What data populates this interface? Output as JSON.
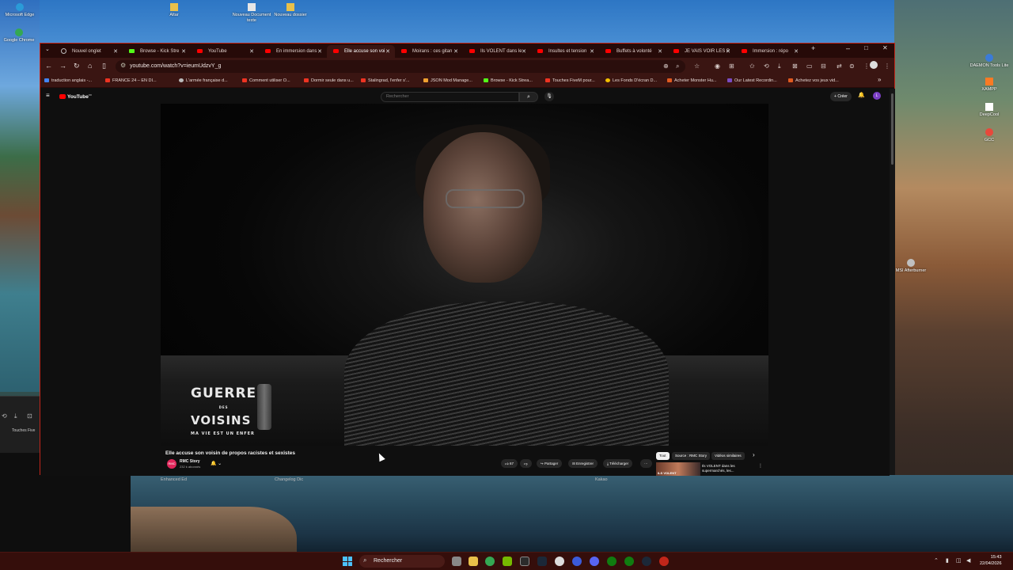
{
  "desktop": {
    "icons_top": [
      {
        "label": "Microsoft Edge"
      },
      {
        "label": "Altar"
      },
      {
        "label": "Nouveau Document texte"
      },
      {
        "label": "Nouveau dossier"
      },
      {
        "label": "Google Chrome"
      }
    ],
    "icons_right": [
      {
        "label": "DAEMON Tools Lite"
      },
      {
        "label": "XAMPP"
      },
      {
        "label": "DeepCool"
      },
      {
        "label": "GCC"
      },
      {
        "label": "MSI Afterburner"
      }
    ],
    "left_fragment_text": "Touches Five",
    "under_browser": [
      "Enhanced Ed",
      "Changelog Dic",
      "Kakao"
    ]
  },
  "browser": {
    "tabs": [
      {
        "title": "Nouvel onglet",
        "icon": "chrome"
      },
      {
        "title": "Browse - Kick Stre",
        "icon": "kick"
      },
      {
        "title": "YouTube",
        "icon": "youtube"
      },
      {
        "title": "En immersion dans",
        "icon": "youtube"
      },
      {
        "title": "Elle accuse son voi",
        "icon": "youtube",
        "active": true
      },
      {
        "title": "Moirans : ces gitan",
        "icon": "youtube"
      },
      {
        "title": "Ils VOLENT dans le",
        "icon": "youtube"
      },
      {
        "title": "Insultes et tension",
        "icon": "youtube"
      },
      {
        "title": "Buffets à volonté",
        "icon": "youtube"
      },
      {
        "title": "JE VAIS VOIR LES P",
        "icon": "youtube"
      },
      {
        "title": "Immersion : répo",
        "icon": "youtube"
      }
    ],
    "new_tab": "+",
    "window_controls": {
      "minimize": "–",
      "maximize": "□",
      "close": "✕"
    },
    "url": "youtube.com/watch?v=ieumUdzvY_g",
    "bookmarks": [
      "traduction anglais -...",
      "FRANCE 24 – EN DI...",
      "L'armée française d...",
      "Comment utiliser O...",
      "Dormir seule dans u...",
      "Stalingrad, l'enfer s'...",
      "JSON Mod Manage...",
      "Browse - Kick Strea...",
      "Touches FiveM pour...",
      "Les Fonds D'écran D...",
      "Acheter Monster Hu...",
      "Our Latest Recordin...",
      "Achetez vos jeux vid..."
    ],
    "bookmarks_more": "»"
  },
  "youtube": {
    "logo": "YouTube",
    "logo_country": "FR",
    "search_placeholder": "Rechercher",
    "create_label": "Créer",
    "avatar_letter": "L",
    "video": {
      "overlay_line1": "GUERRE",
      "overlay_line2": "DES",
      "overlay_line3": "VOISINS",
      "overlay_line4": "MA VIE EST UN ENFER"
    },
    "title": "Elle accuse son voisin de propos racistes et sexistes",
    "channel": {
      "name": "RMC Story",
      "subs": "232 k abonnés",
      "avatar_text": "RMC"
    },
    "actions": {
      "likes": "67",
      "share": "Partager",
      "save": "Enregistrer",
      "download": "Télécharger",
      "more": "···"
    },
    "chips": [
      "Tout",
      "Source : RMC Story",
      "Vidéos similaires"
    ],
    "chip_next": "›",
    "recommendation": {
      "title": "Ils VOLENT dans les supermarchés, les...",
      "thumb_text": "ILS VOLENT"
    }
  },
  "taskbar": {
    "search_label": "Rechercher",
    "time": "15:43",
    "date": "22/04/2026"
  }
}
